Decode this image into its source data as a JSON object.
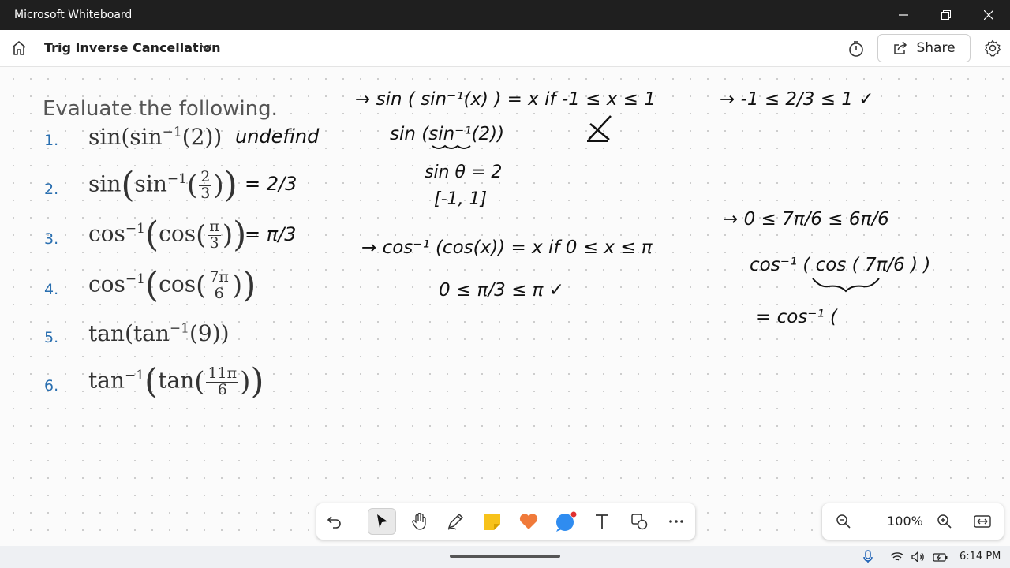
{
  "window": {
    "app_title": "Microsoft Whiteboard"
  },
  "toolbar": {
    "board_title": "Trig Inverse Cancellation",
    "share_label": "Share"
  },
  "canvas": {
    "heading": "Evaluate the following.",
    "items": [
      {
        "num": "1."
      },
      {
        "num": "2."
      },
      {
        "num": "3."
      },
      {
        "num": "4."
      },
      {
        "num": "5."
      },
      {
        "num": "6."
      }
    ],
    "fractions": {
      "two_thirds_num": "2",
      "two_thirds_den": "3",
      "pi_third_num": "π",
      "pi_third_den": "3",
      "seven_pi_six_num": "7π",
      "seven_pi_six_den": "6",
      "eleven_pi_six_num": "11π",
      "eleven_pi_six_den": "6"
    },
    "handwriting": {
      "q1_answer": "undefind",
      "q2_answer": "= 2/3",
      "q3_answer": "= π/3",
      "rule_sin": "→ sin ( sin⁻¹(x) ) = x  if  -1 ≤ x ≤ 1",
      "sin_example": "sin (sin⁻¹(2))",
      "sin_theta": "sin θ = 2",
      "interval": "[-1, 1]",
      "check_two_thirds": "→ -1 ≤ 2/3 ≤ 1 ✓",
      "rule_cos": "→ cos⁻¹ (cos(x)) = x  if  0 ≤ x ≤ π",
      "check_pi_third": "0 ≤ π/3 ≤ π ✓",
      "check_seven_pi_six": "→ 0 ≤ 7π/6 ≤ 6π/6",
      "cos_seven_pi_six": "cos⁻¹ ( cos ( 7π/6 ) )",
      "cos_partial": "= cos⁻¹ ("
    }
  },
  "zoom": {
    "level": "100%"
  },
  "taskbar": {
    "time": "6:14 PM"
  }
}
